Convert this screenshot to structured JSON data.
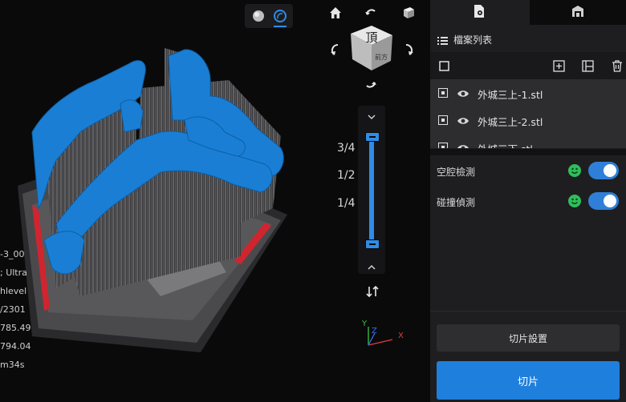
{
  "viewport": {
    "info_lines": [
      "-3_00",
      "; Ultra",
      "hlevel",
      "/2301",
      "785.49",
      "794.04",
      "m34s"
    ],
    "plate_label": "Front",
    "view_cube": {
      "top_face": "頂",
      "front_face": "前方"
    },
    "layer_fractions": [
      "3/4",
      "1/2",
      "1/4"
    ],
    "layer_range": {
      "top": 1.0,
      "bottom": 0.0
    },
    "axes": {
      "x": "X",
      "y": "Y",
      "z": "Z"
    }
  },
  "panel": {
    "title": "檔案列表",
    "files": [
      {
        "name": "外城三上-1.stl"
      },
      {
        "name": "外城三上-2.stl"
      },
      {
        "name": "外城三下.stl"
      }
    ],
    "checks": [
      {
        "label": "空腔檢測",
        "enabled": true
      },
      {
        "label": "碰撞偵測",
        "enabled": true
      }
    ],
    "settings_button": "切片設置",
    "slice_button": "切片"
  },
  "colors": {
    "accent": "#2f8ce6",
    "model": "#1a7fd4",
    "ok": "#2fbe5a",
    "plate_red": "#d0252f"
  }
}
